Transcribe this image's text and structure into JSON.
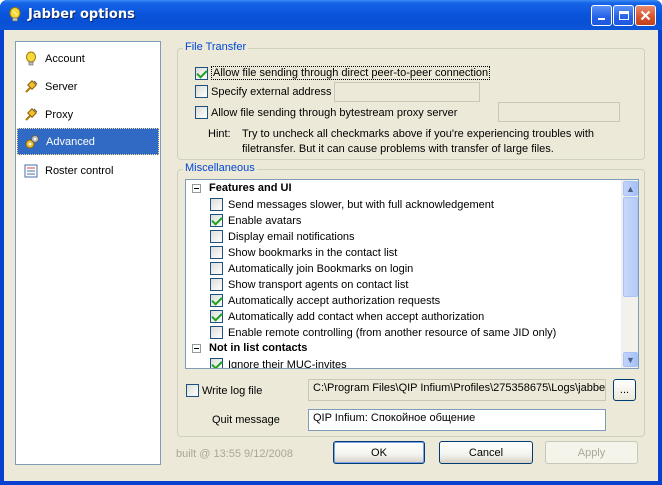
{
  "window": {
    "title": "Jabber options"
  },
  "sidebar": {
    "items": [
      {
        "label": "Account",
        "icon": "bulb-icon"
      },
      {
        "label": "Server",
        "icon": "plug-icon"
      },
      {
        "label": "Proxy",
        "icon": "plug-icon"
      },
      {
        "label": "Advanced",
        "icon": "gears-icon",
        "selected": true
      },
      {
        "label": "Roster control",
        "icon": "contact-list-icon"
      }
    ]
  },
  "file_transfer": {
    "group_title": "File Transfer",
    "p2p_label": "Allow file sending through direct peer-to-peer connection",
    "p2p_checked": true,
    "external_address_label": "Specify external address",
    "external_address_checked": false,
    "external_address_value": "",
    "bytestream_label": "Allow file sending through bytestream proxy server",
    "bytestream_checked": false,
    "bytestream_value": "",
    "hint_label": "Hint:",
    "hint_line1": "Try to uncheck all checkmarks above if you're experiencing troubles with",
    "hint_line2": "filetransfer. But it can cause problems with transfer of large files."
  },
  "misc": {
    "group_title": "Miscellaneous",
    "sections": [
      {
        "title": "Features and UI",
        "items": [
          {
            "label": "Send messages slower, but with full acknowledgement",
            "checked": false
          },
          {
            "label": "Enable avatars",
            "checked": true
          },
          {
            "label": "Display email notifications",
            "checked": false
          },
          {
            "label": "Show bookmarks in the contact list",
            "checked": false
          },
          {
            "label": "Automatically join Bookmarks on login",
            "checked": false
          },
          {
            "label": "Show transport agents on contact list",
            "checked": false
          },
          {
            "label": "Automatically accept authorization requests",
            "checked": true
          },
          {
            "label": "Automatically add contact when accept authorization",
            "checked": true
          },
          {
            "label": "Enable remote controlling (from another resource of same JID only)",
            "checked": false
          }
        ]
      },
      {
        "title": "Not in list contacts",
        "items": [
          {
            "label": "Ignore their MUC-invites",
            "checked": true
          }
        ]
      }
    ],
    "scroll_position": 0.0
  },
  "log": {
    "write_log_label": "Write log file",
    "write_log_checked": false,
    "path": "C:\\Program Files\\QIP Infium\\Profiles\\275358675\\Logs\\jabbe",
    "browse_label": "..."
  },
  "quit": {
    "label": "Quit message",
    "value": "QIP Infium: Спокойное общение"
  },
  "footer": {
    "build_info": "built @ 13:55 9/12/2008",
    "ok_label": "OK",
    "cancel_label": "Cancel",
    "apply_label": "Apply"
  },
  "colors": {
    "titlebar": "#0a55dc",
    "selection": "#316ac5",
    "group_label": "#0046d5"
  }
}
